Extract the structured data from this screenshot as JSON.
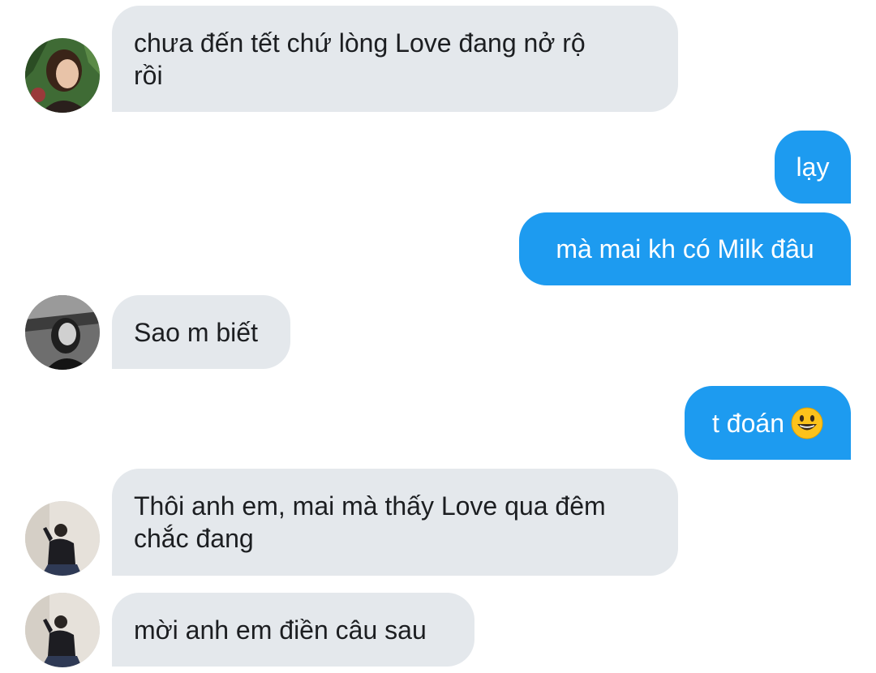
{
  "messages": [
    {
      "side": "in",
      "sender_avatar": "avatar-woman-plants",
      "lines": [
        "chưa đến tết chứ lòng Love đang nở rộ",
        "rồi"
      ]
    },
    {
      "side": "out",
      "text": "lạy"
    },
    {
      "side": "out",
      "text": "mà mai kh có Milk đâu"
    },
    {
      "side": "in",
      "sender_avatar": "avatar-woman-bw",
      "text": "Sao m biết"
    },
    {
      "side": "out",
      "text": "t đoán",
      "emoji": "smiling-face-icon"
    },
    {
      "side": "in",
      "sender_avatar": "avatar-man-seated",
      "lines": [
        "Thôi anh em, mai mà thấy Love qua đêm",
        "chắc đang"
      ]
    },
    {
      "side": "in",
      "sender_avatar": "avatar-man-seated",
      "text": "mời anh em điền câu sau"
    }
  ],
  "colors": {
    "incoming_bubble": "#e4e8ec",
    "outgoing_bubble": "#1d9bf0",
    "incoming_text": "#1c1e21",
    "outgoing_text": "#ffffff"
  }
}
